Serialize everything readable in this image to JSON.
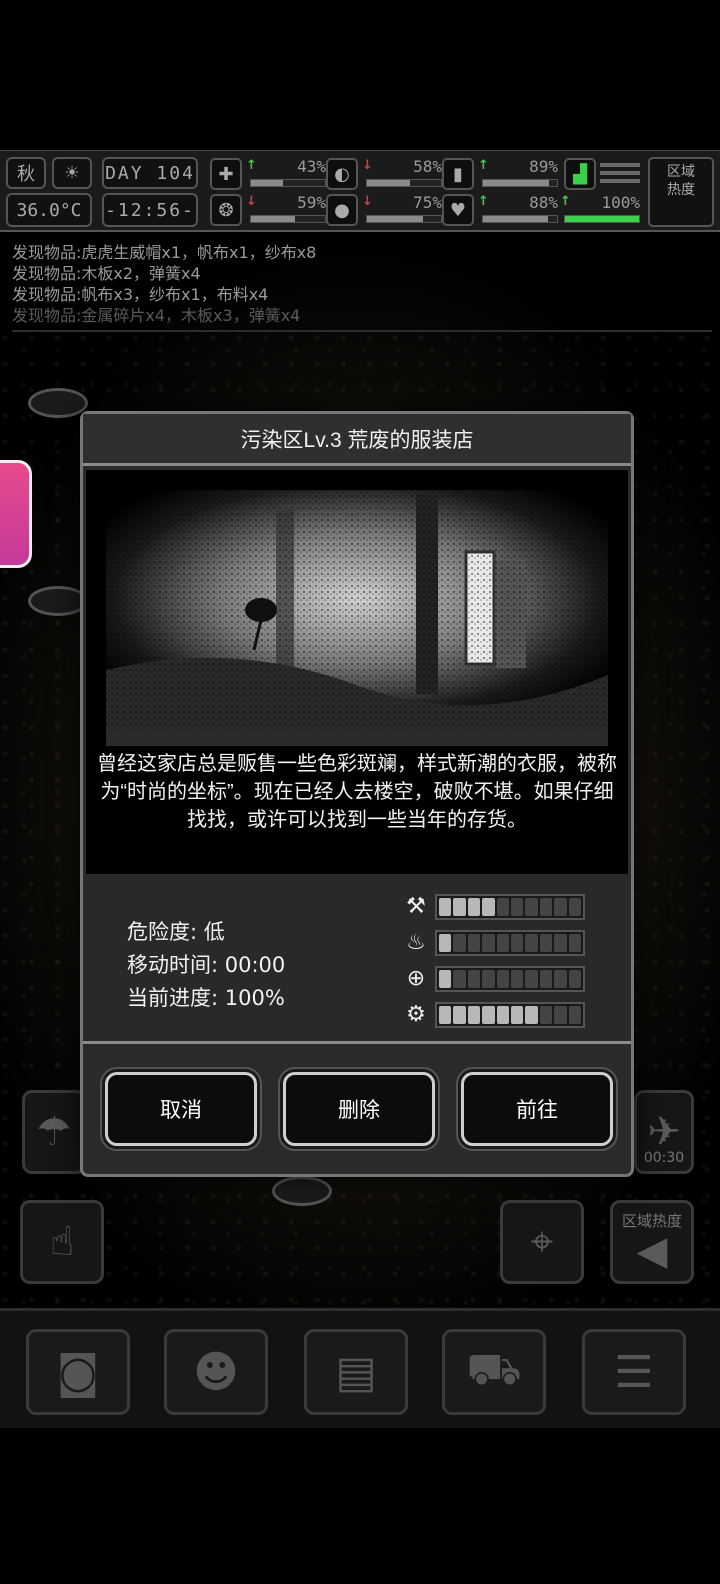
{
  "status": {
    "season": "秋",
    "temperature": "36.0°C",
    "day_label": "DAY",
    "day_number": "104",
    "clock": "-12:56-",
    "stats": [
      {
        "name": "medical",
        "value": "43%",
        "trend": "up",
        "fill": 0.43,
        "icon": "medkit-icon"
      },
      {
        "name": "hunger",
        "value": "58%",
        "trend": "down",
        "fill": 0.58,
        "icon": "stomach-icon"
      },
      {
        "name": "stamina",
        "value": "89%",
        "trend": "up",
        "fill": 0.89,
        "icon": "battery-icon"
      },
      {
        "name": "mood",
        "value": "59%",
        "trend": "down",
        "fill": 0.59,
        "icon": "brain-icon"
      },
      {
        "name": "thirst",
        "value": "75%",
        "trend": "down",
        "fill": 0.75,
        "icon": "water-drop-icon"
      },
      {
        "name": "health",
        "value": "88%",
        "trend": "up",
        "fill": 0.88,
        "icon": "heart-icon"
      }
    ],
    "exposure_value": "100%",
    "region_heat_label": "区域\n热度"
  },
  "log": [
    "发现物品:虎虎生威帽x1，帆布x1，纱布x8",
    "发现物品:木板x2，弹簧x4",
    "发现物品:帆布x3，纱布x1，布料x4",
    "发现物品:金属碎片x4，木板x3，弹簧x4"
  ],
  "modal": {
    "title": "污染区Lv.3 荒废的服装店",
    "description": "曾经这家店总是贩售一些色彩斑斓，样式新潮的衣服，被称为“时尚的坐标”。现在已经人去楼空，破败不堪。如果仔细找找，或许可以找到一些当年的存货。",
    "danger": "危险度: 低",
    "travel_time": "移动时间: 00:00",
    "progress": "当前进度: 100%",
    "resources": [
      {
        "icon": "pickaxe-icon",
        "level": 4,
        "max": 10
      },
      {
        "icon": "meat-icon",
        "level": 1,
        "max": 10
      },
      {
        "icon": "medical-bag-icon",
        "level": 1,
        "max": 10
      },
      {
        "icon": "gears-icon",
        "level": 7,
        "max": 10
      }
    ],
    "cancel_label": "取消",
    "delete_label": "删除",
    "go_label": "前往"
  },
  "side": {
    "timer": "00:30",
    "region_heat": "区域热度"
  }
}
